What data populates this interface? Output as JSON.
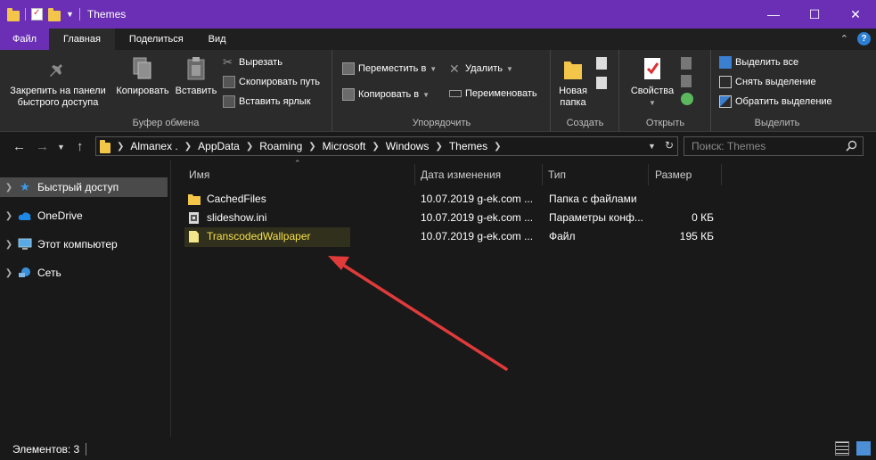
{
  "window": {
    "title": "Themes",
    "controls": {
      "minimize": "—",
      "maximize": "☐",
      "close": "✕"
    }
  },
  "ribbon_tabs": [
    {
      "label": "Файл"
    },
    {
      "label": "Главная"
    },
    {
      "label": "Поделиться"
    },
    {
      "label": "Вид"
    }
  ],
  "ribbon": {
    "clipboard": {
      "group_label": "Буфер обмена",
      "pin_label_1": "Закрепить на панели",
      "pin_label_2": "быстрого доступа",
      "copy": "Копировать",
      "paste": "Вставить",
      "cut": "Вырезать",
      "copy_path": "Скопировать путь",
      "paste_shortcut": "Вставить ярлык"
    },
    "organize": {
      "group_label": "Упорядочить",
      "move_to": "Переместить в",
      "copy_to": "Копировать в",
      "delete": "Удалить",
      "rename": "Переименовать"
    },
    "new": {
      "group_label": "Создать",
      "new_folder_1": "Новая",
      "new_folder_2": "папка"
    },
    "open": {
      "group_label": "Открыть",
      "properties": "Свойства"
    },
    "select": {
      "group_label": "Выделить",
      "select_all": "Выделить все",
      "select_none": "Снять выделение",
      "invert": "Обратить выделение"
    }
  },
  "address": {
    "crumbs": [
      "Almanex .",
      "AppData",
      "Roaming",
      "Microsoft",
      "Windows",
      "Themes"
    ],
    "search_placeholder": "Поиск: Themes"
  },
  "nav_pane": [
    {
      "label": "Быстрый доступ",
      "icon": "star-icon",
      "selected": true
    },
    {
      "label": "OneDrive",
      "icon": "cloud-icon"
    },
    {
      "label": "Этот компьютер",
      "icon": "computer-icon"
    },
    {
      "label": "Сеть",
      "icon": "network-icon"
    }
  ],
  "columns": {
    "name": "Имя",
    "date": "Дата изменения",
    "type": "Тип",
    "size": "Размер"
  },
  "files": [
    {
      "name": "CachedFiles",
      "date": "10.07.2019  g-ek.com ...",
      "type": "Папка с файлами",
      "size": "",
      "icon": "folder-icon"
    },
    {
      "name": "slideshow.ini",
      "date": "10.07.2019  g-ek.com ...",
      "type": "Параметры конф...",
      "size": "0 КБ",
      "icon": "settings-file-icon"
    },
    {
      "name": "TranscodedWallpaper",
      "date": "10.07.2019  g-ek.com ...",
      "type": "Файл",
      "size": "195 КБ",
      "icon": "file-icon"
    }
  ],
  "status": {
    "items": "Элементов: 3"
  },
  "colors": {
    "titlebar": "#6b2fb5",
    "arrow": "#e03a3a",
    "highlight_text": "#f7e04a"
  }
}
